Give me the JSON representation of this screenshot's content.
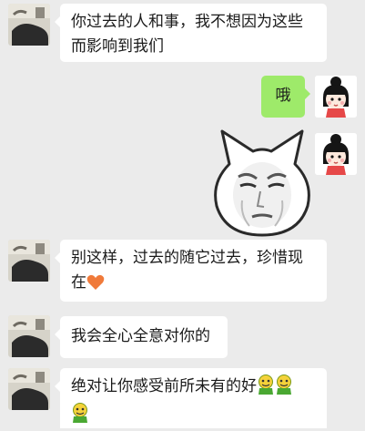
{
  "colors": {
    "background": "#ebebeb",
    "bubble_incoming": "#ffffff",
    "bubble_outgoing": "#9eea6a",
    "text": "#1a1a1a"
  },
  "messages": [
    {
      "sender": "other",
      "text": "你过去的人和事，我不想因为这些而影响到我们"
    },
    {
      "sender": "me",
      "text": "哦"
    },
    {
      "sender": "me",
      "type": "sticker",
      "sticker_icon": "cat-face-meme-sticker"
    },
    {
      "sender": "other",
      "text": "别这样，过去的随它过去，珍惜现在",
      "trailing_emoji": "orange-heart-icon"
    },
    {
      "sender": "other",
      "text": "我会全心全意对你的"
    },
    {
      "sender": "other",
      "text": "绝对让你感受前所未有的好",
      "trailing_emojis": [
        "green-face-emoji-icon",
        "green-face-emoji-icon",
        "green-face-emoji-icon"
      ]
    }
  ]
}
